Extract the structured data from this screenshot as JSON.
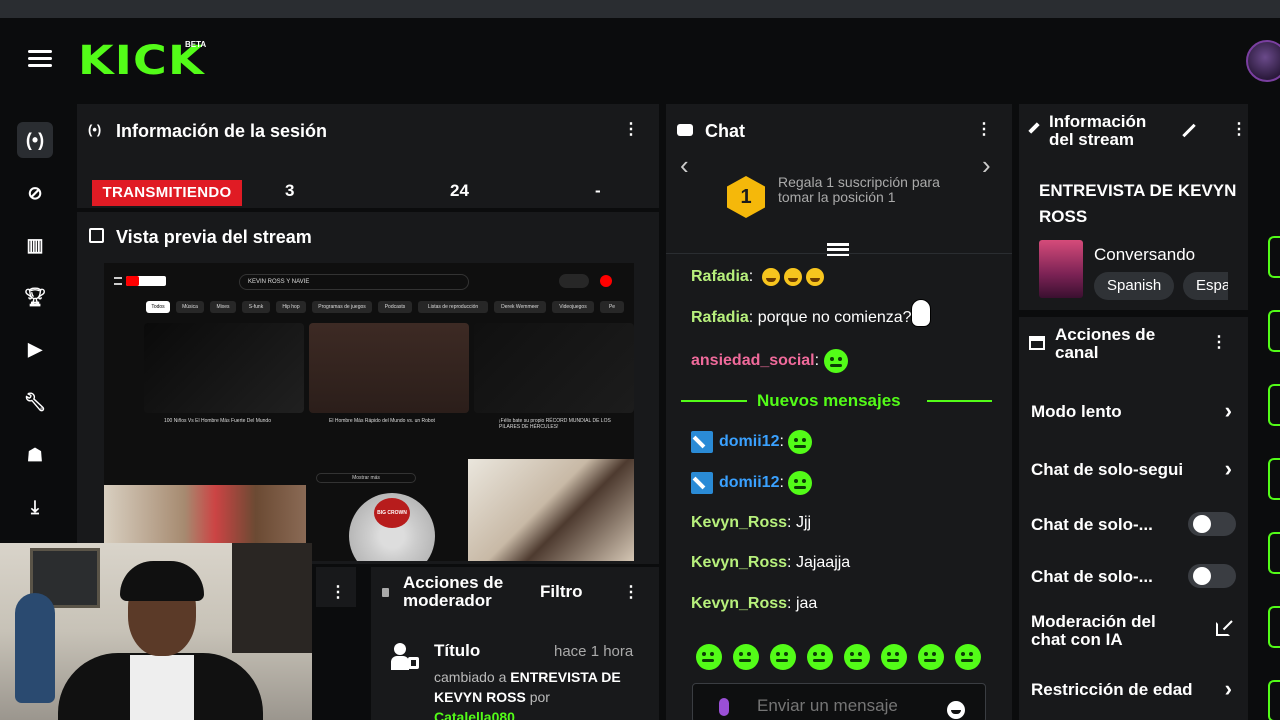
{
  "header": {
    "logo": "KICK",
    "beta": "BETA"
  },
  "session": {
    "title": "Información de la sesión",
    "live_badge": "TRANSMITIENDO",
    "stat_1": "3",
    "stat_2": "24",
    "stat_3": "-"
  },
  "preview": {
    "title": "Vista previa del stream",
    "search_text": "KEVIN ROSS Y NAVIE",
    "chips": [
      "Todos",
      "Música",
      "Mixes",
      "S-funk",
      "Hip hop",
      "Programas de juegos",
      "Podcasts",
      "Listas de reproducción",
      "Derek Wemmeer",
      "Videojuegos",
      "Pe"
    ],
    "captions": [
      "100 Niños Vs El Hombre Más Fuerte Del Mundo",
      "El Hombre Más Rápido del Mundo vs. un Robot",
      "¡Félix bate su propio RÉCORD MUNDIAL DE LOS PILARES DE HÉRCULES!"
    ],
    "show_more": "Mostrar más",
    "cd_label": "BIG CROWN"
  },
  "moderator": {
    "title": "Acciones de moderador",
    "filter": "Filtro",
    "event_title": "Título",
    "event_time": "hace 1 hora",
    "event_desc_prefix": "cambiado a",
    "event_desc_value": "ENTREVISTA DE KEVYN ROSS",
    "event_desc_by": "por",
    "event_user": "Catalella080"
  },
  "chat": {
    "title": "Chat",
    "pin_position": "1",
    "pin_text": "Regala 1 suscripción para tomar la posición 1",
    "new_messages": "Nuevos mensajes",
    "placeholder": "Enviar un mensaje",
    "messages": [
      {
        "user": "Rafadia",
        "color": "#b7f07c",
        "text": ""
      },
      {
        "user": "Rafadia",
        "color": "#b7f07c",
        "text": "porque no comienza?"
      },
      {
        "user": "ansiedad_social",
        "color": "#f06a9b",
        "text": ""
      },
      {
        "user": "domii12",
        "color": "#3aa1ff",
        "text": ""
      },
      {
        "user": "domii12",
        "color": "#3aa1ff",
        "text": ""
      },
      {
        "user": "Kevyn_Ross",
        "color": "#b7f07c",
        "text": "Jjj"
      },
      {
        "user": "Kevyn_Ross",
        "color": "#b7f07c",
        "text": "Jajaajja"
      },
      {
        "user": "Kevyn_Ross",
        "color": "#b7f07c",
        "text": "jaa"
      }
    ]
  },
  "stream_info": {
    "title": "Información del stream",
    "stream_title": "ENTREVISTA DE KEVYN ROSS",
    "category": "Conversando",
    "tags": [
      "Spanish",
      "Espa"
    ]
  },
  "channel_actions": {
    "title": "Acciones de canal",
    "items": [
      "Modo lento",
      "Chat de solo-segui",
      "Chat de solo-...",
      "Chat de solo-...",
      "Moderación del chat con IA",
      "Restricción de edad"
    ]
  }
}
